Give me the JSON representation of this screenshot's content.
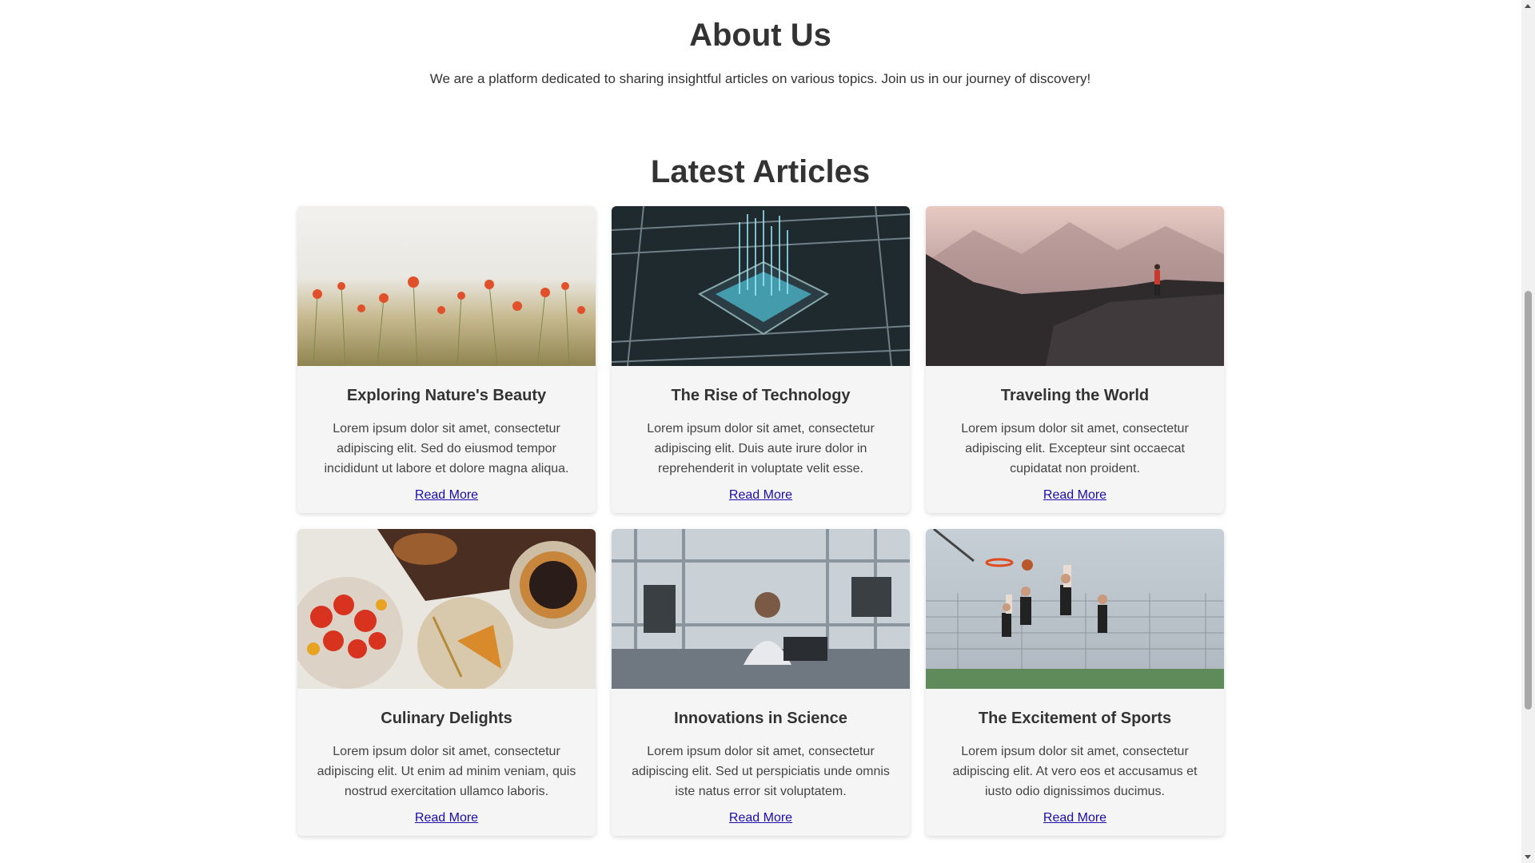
{
  "about": {
    "title": "About Us",
    "text": "We are a platform dedicated to sharing insightful articles on various topics. Join us in our journey of discovery!"
  },
  "latest": {
    "title": "Latest Articles",
    "articles": [
      {
        "title": "Exploring Nature's Beauty",
        "text": "Lorem ipsum dolor sit amet, consectetur adipiscing elit. Sed do eiusmod tempor incididunt ut labore et dolore magna aliqua.",
        "link": "Read More",
        "image": "poppy-field-image"
      },
      {
        "title": "The Rise of Technology",
        "text": "Lorem ipsum dolor sit amet, consectetur adipiscing elit. Duis aute irure dolor in reprehenderit in voluptate velit esse.",
        "link": "Read More",
        "image": "circuit-chip-image"
      },
      {
        "title": "Traveling the World",
        "text": "Lorem ipsum dolor sit amet, consectetur adipiscing elit. Excepteur sint occaecat cupidatat non proident.",
        "link": "Read More",
        "image": "mountain-rocks-image"
      },
      {
        "title": "Culinary Delights",
        "text": "Lorem ipsum dolor sit amet, consectetur adipiscing elit. Ut enim ad minim veniam, quis nostrud exercitation ullamco laboris.",
        "link": "Read More",
        "image": "food-table-image"
      },
      {
        "title": "Innovations in Science",
        "text": "Lorem ipsum dolor sit amet, consectetur adipiscing elit. Sed ut perspiciatis unde omnis iste natus error sit voluptatem.",
        "link": "Read More",
        "image": "science-lab-image"
      },
      {
        "title": "The Excitement of Sports",
        "text": "Lorem ipsum dolor sit amet, consectetur adipiscing elit. At vero eos et accusamus et iusto odio dignissimos ducimus.",
        "link": "Read More",
        "image": "basketball-image"
      }
    ]
  },
  "colors": {
    "text": "#333333",
    "link": "#1a0dab",
    "card_background": "#f5f5f5"
  }
}
